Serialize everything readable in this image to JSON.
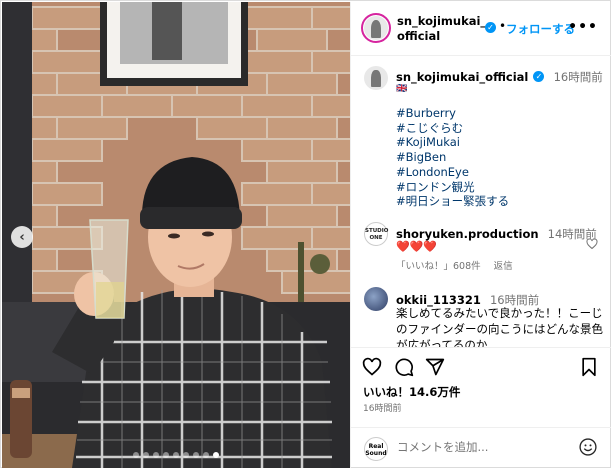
{
  "header": {
    "username": "sn_kojimukai_official",
    "separator": "•",
    "follow_label": "フォローする",
    "more_label": "•••"
  },
  "caption": {
    "username": "sn_kojimukai_official",
    "time": "16時間前",
    "flag": "🇬🇧",
    "hashtags": [
      "#Burberry",
      "#こじぐらむ",
      "#KojiMukai",
      "#BigBen",
      "#LondonEye",
      "#ロンドン観光",
      "#明日ショー緊張する"
    ]
  },
  "comments": [
    {
      "username": "shoryuken.production",
      "time": "14時間前",
      "text": "❤️❤️❤️",
      "likes": "「いいね！」608件",
      "reply": "返信",
      "avatar_text": "STUDIO ONE"
    },
    {
      "username": "okkii_113321",
      "time": "16時間前",
      "text": "楽しめてるみたいで良かった！！こーじのファインダーの向こうにはどんな景色が広がってるのか"
    }
  ],
  "actions": {
    "likes": "いいね！14.6万件",
    "posted": "16時間前"
  },
  "add_comment": {
    "placeholder": "コメントを追加...",
    "avatar_text": "Real Sound"
  },
  "carousel": {
    "prev_icon": "chevron-left-icon",
    "total_slides": 9,
    "active_slide": 9
  },
  "colors": {
    "link_blue": "#0095f6",
    "hashtag": "#00376b",
    "muted": "#737373",
    "heart": "#e0245e"
  }
}
